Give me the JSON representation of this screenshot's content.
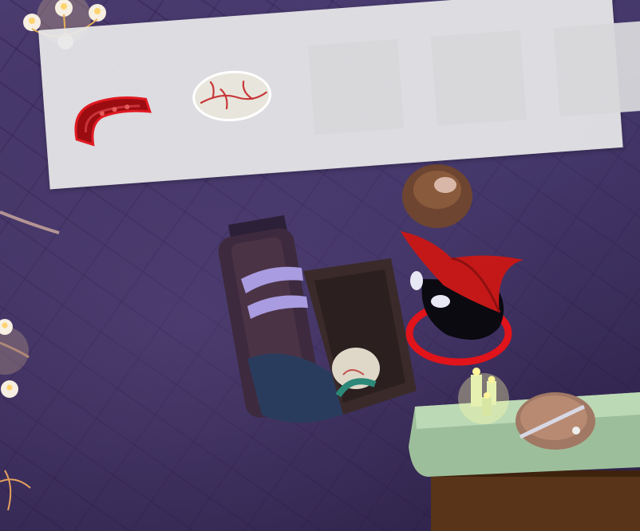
{
  "game": {
    "inventory": {
      "slots": [
        {
          "item_icon": "tentacle-icon",
          "filled": true
        },
        {
          "item_icon": "veined-egg-icon",
          "filled": true
        },
        {
          "item_icon": "",
          "filled": false
        },
        {
          "item_icon": "",
          "filled": false
        },
        {
          "item_icon": "",
          "filled": false
        }
      ]
    },
    "scene": {
      "player_ring_color": "#e0141a",
      "player_hat_color": "#c41818",
      "floor_color": "#3b2d5c"
    }
  }
}
